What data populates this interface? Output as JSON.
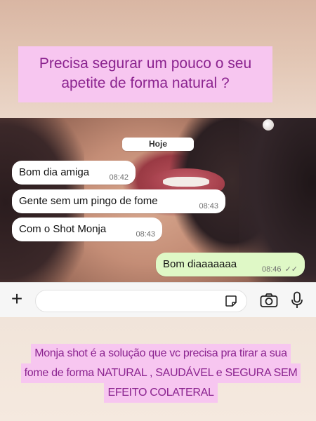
{
  "top_banner": {
    "text": "Precisa segurar um pouco o seu apetite de forma natural ?"
  },
  "chat": {
    "date_chip": "Hoje",
    "messages": [
      {
        "direction": "in",
        "text": "Bom dia amiga",
        "time": "08:42"
      },
      {
        "direction": "in",
        "text": "Gente sem um pingo de fome",
        "time": "08:43"
      },
      {
        "direction": "in",
        "text": "Com o Shot Monja",
        "time": "08:43"
      },
      {
        "direction": "out",
        "text": "Bom diaaaaaaa",
        "time": "08:46",
        "status": "read"
      }
    ],
    "colors": {
      "incoming_bubble": "#ffffff",
      "outgoing_bubble": "#dff8c6",
      "input_bar": "#f6f6f6"
    }
  },
  "input_bar": {
    "icons": [
      "plus-icon",
      "sticker-icon",
      "camera-icon",
      "mic-icon"
    ],
    "field_value": ""
  },
  "bottom_banner": {
    "lines": [
      "Monja shot é a solução que vc precisa pra tirar a sua",
      "fome  de forma NATURAL , SAUDÁVEL e SEGURA SEM",
      "EFEITO COLATERAL"
    ]
  },
  "colors": {
    "banner_bg": "#f7c6f0",
    "banner_text": "#8b238f"
  }
}
